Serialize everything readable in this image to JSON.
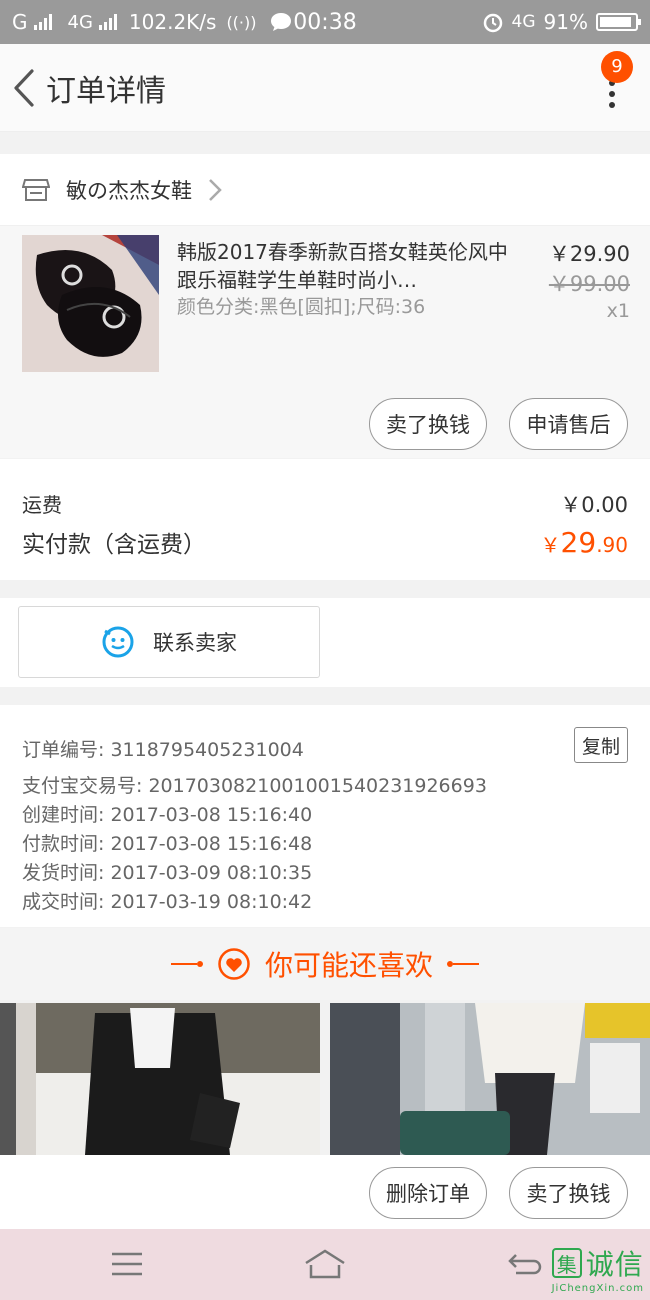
{
  "status_bar": {
    "carrier": "G",
    "network1": "4G",
    "speed": "102.2K/s",
    "time": "00:38",
    "network2": "4G",
    "battery": "91%",
    "battery_level": 0.91
  },
  "nav": {
    "title": "订单详情",
    "badge_count": "9"
  },
  "shop": {
    "name": "敏の杰杰女鞋"
  },
  "product": {
    "title": "韩版2017春季新款百搭女鞋英伦风中跟乐福鞋学生单鞋时尚小…",
    "sku": "颜色分类:黑色[圆扣];尺码:36",
    "price": "￥29.90",
    "original_price": "￥99.00",
    "quantity": "x1",
    "actions": [
      "卖了换钱",
      "申请售后"
    ]
  },
  "fees": {
    "shipping_label": "运费",
    "shipping_value": "￥0.00",
    "paid_label": "实付款（含运费）",
    "paid_currency": "￥",
    "paid_int": "29",
    "paid_dec": ".90"
  },
  "contact": {
    "label": "联系卖家"
  },
  "order_info": {
    "copy_label": "复制",
    "lines": [
      "订单编号: 3118795405231004",
      "支付宝交易号: 2017030821001001540231926693",
      "创建时间: 2017-03-08 15:16:40",
      "付款时间: 2017-03-08 15:16:48",
      "发货时间: 2017-03-09 08:10:35",
      "成交时间: 2017-03-19 08:10:42"
    ]
  },
  "recommend": {
    "title": "你可能还喜欢"
  },
  "bottom_actions": [
    "删除订单",
    "卖了换钱"
  ],
  "watermark": {
    "logo": "集",
    "text": "诚信",
    "sub": "JiChengXin.com"
  },
  "colors": {
    "accent": "#ff5000",
    "contact_icon": "#1aa3e8"
  }
}
